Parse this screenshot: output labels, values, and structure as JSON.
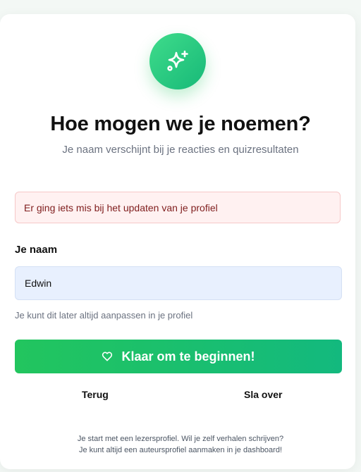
{
  "header": {
    "logo_icon": "sparkles-icon",
    "title": "Hoe mogen we je noemen?",
    "subtitle": "Je naam verschijnt bij je reacties en quizresultaten"
  },
  "error": {
    "message": "Er ging iets mis bij het updaten van je profiel"
  },
  "form": {
    "name_label": "Je naam",
    "name_value": "Edwin",
    "hint": "Je kunt dit later altijd aanpassen in je profiel"
  },
  "actions": {
    "submit_label": "Klaar om te beginnen!",
    "submit_icon": "heart-icon",
    "back_label": "Terug",
    "skip_label": "Sla over"
  },
  "footer": {
    "line1": "Je start met een lezersprofiel. Wil je zelf verhalen schrijven?",
    "line2": "Je kunt altijd een auteursprofiel aanmaken in je dashboard!"
  },
  "colors": {
    "accent": "#22c55e",
    "accent_dark": "#13b97e",
    "error_bg": "#fff1f1",
    "error_text": "#7f1d1d",
    "input_bg": "#e8f0fe"
  }
}
